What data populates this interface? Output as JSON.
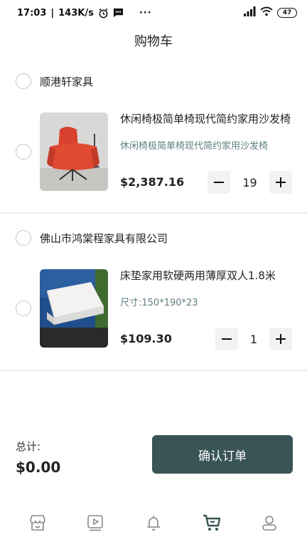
{
  "status_bar": {
    "time": "17:03",
    "speed": "143K/s",
    "dots": "···",
    "battery": "47"
  },
  "header": {
    "title": "购物车"
  },
  "stores": [
    {
      "name": "顺港轩家具",
      "item": {
        "title": "休闲椅极简单椅现代简约家用沙发椅",
        "spec": "休闲椅极简单椅现代简约家用沙发椅",
        "price": "$2,387.16",
        "qty": "19",
        "image": "orange-leather-armchair"
      }
    },
    {
      "name": "佛山市鸿棠程家具有限公司",
      "item": {
        "title": "床垫家用软硬两用薄厚双人1.8米",
        "spec": "尺寸:150*190*23",
        "price": "$109.30",
        "qty": "1",
        "image": "white-mattress"
      }
    }
  ],
  "footer": {
    "total_label": "总计:",
    "total_value": "$0.00",
    "confirm_label": "确认订单"
  },
  "nav": {
    "items": [
      "shop-icon",
      "video-icon",
      "bell-icon",
      "cart-icon",
      "user-icon"
    ],
    "active": "cart-icon"
  },
  "colors": {
    "accent": "#385456",
    "spec_text": "#5f7f80",
    "divider": "#eeeeee",
    "stepper_bg": "#f2f2f2"
  }
}
